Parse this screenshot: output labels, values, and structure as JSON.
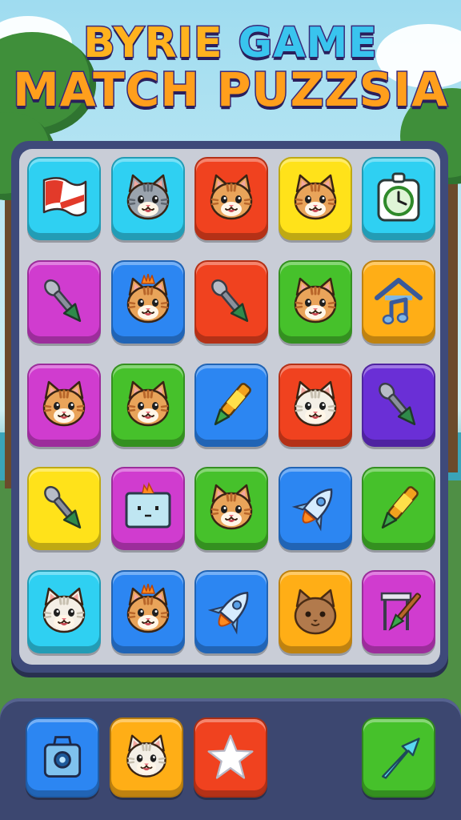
{
  "title": {
    "line1_word1": "BYRIE",
    "line1_word2": "GAME",
    "line2": "MATCH PUZZSIA"
  },
  "colors": {
    "cyan": "#2fd0f2",
    "red": "#f0421f",
    "yellow": "#ffe21a",
    "magenta": "#d03ccf",
    "blue": "#2c86f2",
    "green": "#46c12b",
    "orange": "#ffae16",
    "purple": "#6a2fd6",
    "board": "#3e4a7a"
  },
  "board": {
    "rows": [
      [
        {
          "color": "cyan",
          "icon": "flag-icon"
        },
        {
          "color": "cyan",
          "icon": "gray-cat-icon"
        },
        {
          "color": "red",
          "icon": "cat-icon"
        },
        {
          "color": "yellow",
          "icon": "cat-icon"
        },
        {
          "color": "cyan",
          "icon": "clock-icon"
        }
      ],
      [
        {
          "color": "magenta",
          "icon": "brush-icon"
        },
        {
          "color": "blue",
          "icon": "crowned-cat-icon"
        },
        {
          "color": "red",
          "icon": "brush-icon"
        },
        {
          "color": "green",
          "icon": "cat-icon"
        },
        {
          "color": "orange",
          "icon": "house-music-icon"
        }
      ],
      [
        {
          "color": "magenta",
          "icon": "cat-icon"
        },
        {
          "color": "green",
          "icon": "cat-icon"
        },
        {
          "color": "blue",
          "icon": "pencil-icon"
        },
        {
          "color": "red",
          "icon": "white-cat-icon"
        },
        {
          "color": "purple",
          "icon": "brush-icon"
        }
      ],
      [
        {
          "color": "yellow",
          "icon": "brush-icon"
        },
        {
          "color": "magenta",
          "icon": "robot-box-icon"
        },
        {
          "color": "green",
          "icon": "cat-icon"
        },
        {
          "color": "blue",
          "icon": "rocket-icon"
        },
        {
          "color": "green",
          "icon": "pencil-icon"
        }
      ],
      [
        {
          "color": "cyan",
          "icon": "white-cat-icon"
        },
        {
          "color": "blue",
          "icon": "crowned-cat-icon"
        },
        {
          "color": "blue",
          "icon": "rocket-icon"
        },
        {
          "color": "orange",
          "icon": "brown-cat-icon"
        },
        {
          "color": "magenta",
          "icon": "easel-brush-icon"
        }
      ]
    ]
  },
  "tray": [
    {
      "color": "blue",
      "icon": "camera-bag-icon",
      "slot": 0
    },
    {
      "color": "orange",
      "icon": "white-cat-icon",
      "slot": 1
    },
    {
      "color": "red",
      "icon": "star-icon",
      "slot": 2
    },
    {
      "color": "green",
      "icon": "arrow-icon",
      "slot": 4
    }
  ]
}
